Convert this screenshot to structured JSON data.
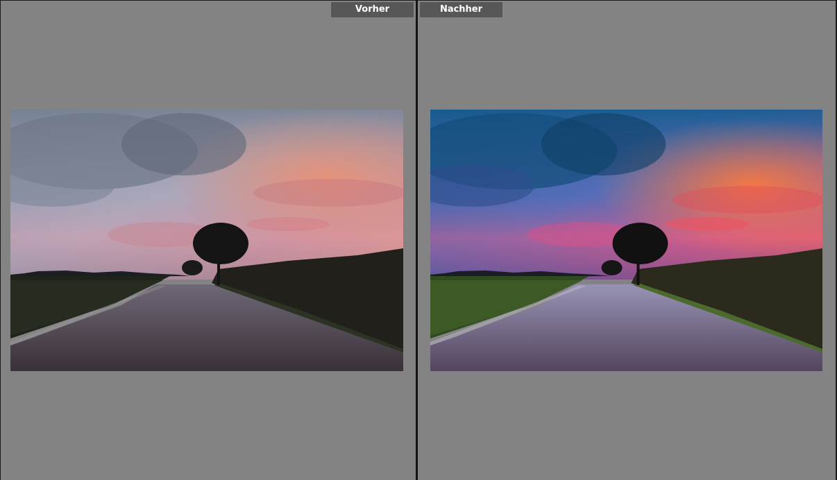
{
  "labels": {
    "before": "Vorher",
    "after": "Nachher"
  },
  "colors": {
    "background": "#838383",
    "label_bg": "#575757",
    "label_text": "#ffffff",
    "divider": "#141414"
  }
}
